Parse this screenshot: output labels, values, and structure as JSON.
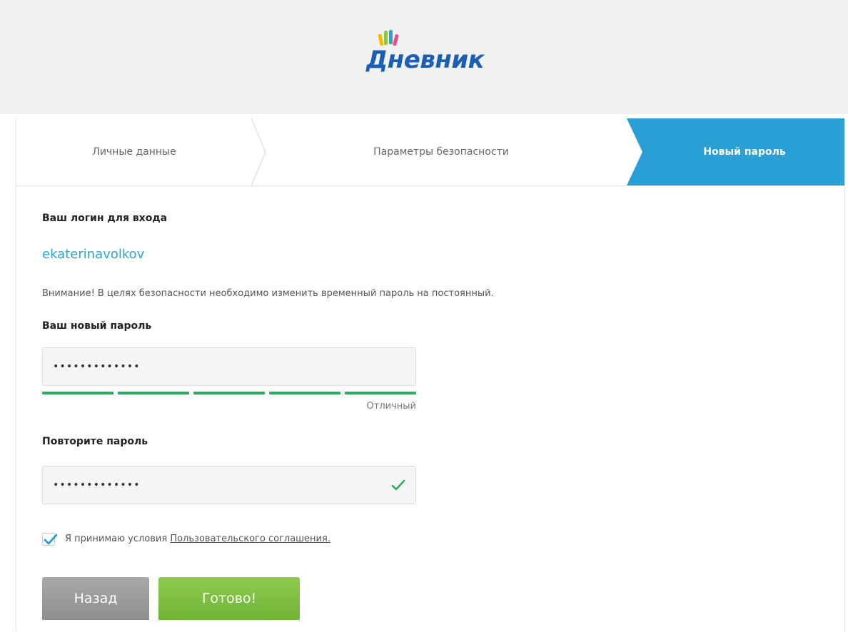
{
  "brand": {
    "logo_text": "Дневник",
    "colors": {
      "primary": "#1a5fb5",
      "accent": "#2a9fd6"
    }
  },
  "steps": [
    {
      "label": "Личные данные",
      "active": false
    },
    {
      "label": "Параметры безопасности",
      "active": false
    },
    {
      "label": "Новый пароль",
      "active": true
    }
  ],
  "form": {
    "login_title": "Ваш логин для входа",
    "login_value": "ekaterinavolkov",
    "warning": "Внимание! В целях безопасности необходимо изменить временный пароль на постоянный.",
    "new_password": {
      "label": "Ваш новый пароль",
      "value": "•••••••••••••",
      "strength_label": "Отличный",
      "strength_level": 5,
      "strength_max": 5,
      "strength_color": "#27ae60"
    },
    "repeat_password": {
      "label": "Повторите пароль",
      "value": "•••••••••••••",
      "valid": true,
      "valid_icon": "check-icon"
    },
    "agree": {
      "checked": true,
      "text": "Я принимаю условия",
      "link_text": "Пользовательского соглашения."
    },
    "buttons": {
      "back": "Назад",
      "done": "Готово!"
    }
  }
}
